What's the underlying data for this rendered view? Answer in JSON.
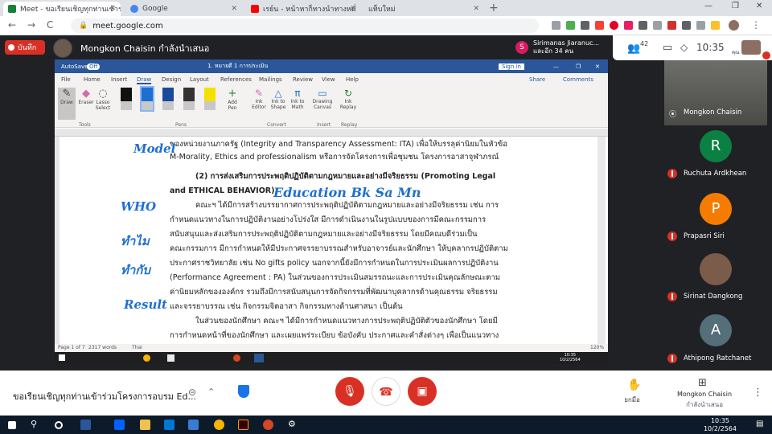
{
  "browser": {
    "tabs": [
      {
        "title": "Meet - ขอเรียนเชิญทุกท่านเข้าร่",
        "active": true,
        "color": "#188038"
      },
      {
        "title": "Google",
        "active": false,
        "color": "#4285f4"
      },
      {
        "title": "เรย์น - หน้าหาก็ทางนำทางหมั่",
        "active": false,
        "color": "#ff0000"
      },
      {
        "title": "แท็บใหม่",
        "active": false,
        "color": "#9aa0a6"
      }
    ],
    "new_tab": "+",
    "url": "meet.google.com",
    "back": "←",
    "forward": "→",
    "reload": "C"
  },
  "meet": {
    "record_label": "บันทึก",
    "presenter_text": "Mongkon Chaisin กำลังนำเสนอ",
    "sir_avatar": "S",
    "sir_name": "Sirimanas Jiaranuc...",
    "sir_sub": "และอีก 34 คน",
    "people_count": "42",
    "time": "10:35",
    "you_label": "คุณ",
    "meeting_title": "ขอเรียนเชิญทุกท่านเข้าร่วมโครงการอบรม Ed...",
    "raise_hand": "ยกมือ",
    "present_name": "Mongkon Chaisin",
    "present_sub": "กำลังนำเสนอ",
    "colors": {
      "end_call": "#d93025",
      "accent": "#1a73e8"
    }
  },
  "participants": [
    {
      "name": "Mongkon Chaisin",
      "type": "video",
      "muted": false
    },
    {
      "name": "Ruchuta Ardkhean",
      "initial": "R",
      "color": "#0b8043",
      "muted": true
    },
    {
      "name": "Prapasri Siri",
      "initial": "P",
      "color": "#f57c00",
      "muted": true
    },
    {
      "name": "Sirinat Dangkong",
      "type": "photo",
      "muted": true
    },
    {
      "name": "Athipong Ratchanet",
      "initial": "A",
      "color": "#546e7a",
      "muted": true
    }
  ],
  "word": {
    "autosave": "AutoSave",
    "autosave_state": "Off",
    "doc_title": "1. หมายดี 1 การประเมิน",
    "signin": "Sign in",
    "menu": [
      "File",
      "Home",
      "Insert",
      "Draw",
      "Design",
      "Layout",
      "References",
      "Mailings",
      "Review",
      "View",
      "Help"
    ],
    "active_menu": "Draw",
    "share": "Share",
    "comments": "Comments",
    "ribbon": {
      "draw": "Draw",
      "eraser": "Eraser",
      "lasso": "Lasso Select",
      "add_pen": "Add Pen",
      "ink_editor": "Ink Editor",
      "ink_shape": "Ink to Shape",
      "ink_math": "Ink to Math",
      "drawing_canvas": "Drawing Canvas",
      "ink_replay": "Ink Replay",
      "groups": [
        "Tools",
        "Pens",
        "Convert",
        "Insert",
        "Replay"
      ]
    },
    "doc_lines": [
      "ของหน่วยงานภาครัฐ (Integrity and Transparency Assessment: ITA) เพื่อให้บรรลุค่านิยมในหัวข้อ",
      "M-Morality, Ethics and professionalism หรือการจัดโครงการเพื่อชุมชน โครงการอาสาจุฬาภรณ์",
      "(2) การส่งเสริมการประพฤติปฏิบัติตามกฎหมายและอย่างมีจริยธรรม (Promoting Legal",
      "and ETHICAL BEHAVIOR)",
      "คณะฯ ได้มีการสร้างบรรยากาศการประพฤติปฏิบัติตามกฎหมายและอย่างมีจริยธรรม เช่น การ",
      "กำหนดแนวทางในการปฏิบัติงานอย่างโปร่งใส มีการดำเนินงานในรูปแบบของการมีคณะกรรมการ",
      "สนับสนุนและส่งเสริมการประพฤติปฏิบัติตามกฎหมายและอย่างมีจริยธรรม โดยมีคณบดีร่วมเป็น",
      "คณะกรรมการ มีการกำหนดให้มีประกาศจรรยาบรรณสำหรับอาจารย์และนักศึกษา ให้บุคลากรปฏิบัติตาม",
      "ประกาศราชวิทยาลัย เช่น No gifts policy นอกจากนี้ยังมีการกำหนดในการประเมินผลการปฏิบัติงาน",
      "(Performance Agreement : PA) ในส่วนของการประเมินสมรรถนะและการประเมินคุณลักษณะตาม",
      "ค่านิยมหลักขององค์กร รวมถึงมีการสนับสนุนการจัดกิจกรรมที่พัฒนาบุคลากรด้านคุณธรรม จริยธรรม",
      "และจรรยาบรรณ เช่น กิจกรรมจิตอาสา กิจกรรมทางด้านศาสนา เป็นต้น",
      "ในส่วนของนักศึกษา คณะฯ ได้มีการกำหนดแนวทางการประพฤติปฏิบัติตัวของนักศึกษา โดยมี",
      "การกำหนดหน้าที่ของนักศึกษา และเผยแพร่ระเบียบ ข้อบังคับ ประกาศและคำสั่งต่างๆ เพื่อเป็นแนวทาง"
    ],
    "ink": {
      "model": "Model",
      "education": "Education  Bk  Sa  Mn",
      "who": "WHO",
      "how": "ทำไม",
      "what": "ทำกับ",
      "result": "Result"
    },
    "status": {
      "page": "Page 1 of 7",
      "words": "2317 words",
      "lang": "Thai",
      "zoom": "120%",
      "time": "10:35",
      "date": "10/2/2564"
    }
  },
  "taskbar": {
    "time": "10:35",
    "date": "10/2/2564"
  }
}
